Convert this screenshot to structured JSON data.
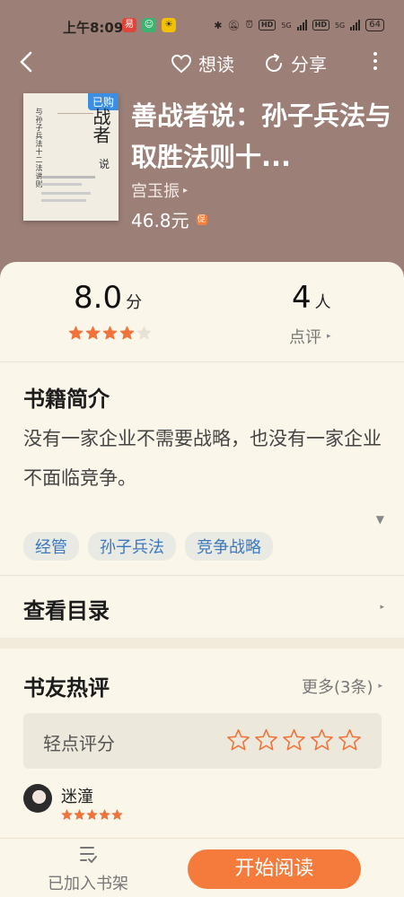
{
  "status_bar": {
    "time": "上午8:09",
    "battery": "64",
    "network": "5G",
    "hd": "HD"
  },
  "header": {
    "want_read_label": "想读",
    "share_label": "分享"
  },
  "book": {
    "purchased_badge": "已购",
    "title": "善战者说：孙子兵法与取胜法则十...",
    "author": "宫玉振",
    "price": "46.8元",
    "price_badge": "促",
    "cover": {
      "vertical_text": "与孙子兵法十二法讲则",
      "big_text": "战者",
      "say_char": "说"
    }
  },
  "rating": {
    "score": "8.0",
    "score_unit": "分",
    "stars_filled": 4,
    "stars_total": 5,
    "reviewer_count": "4",
    "reviewer_unit": "人",
    "reviews_link": "点评"
  },
  "intro": {
    "title": "书籍简介",
    "text": "没有一家企业不需要战略，也没有一家企业不面临竞争。"
  },
  "tags": [
    "经管",
    "孙子兵法",
    "竞争战略"
  ],
  "toc": {
    "label": "查看目录"
  },
  "hot_reviews": {
    "title": "书友热评",
    "more_label": "更多(3条)",
    "rate_prompt": "轻点评分",
    "user_name": "迷潼",
    "user_stars": 5
  },
  "bottom_bar": {
    "shelf_label": "已加入书架",
    "read_button": "开始阅读"
  },
  "colors": {
    "header_bg": "#9c7f77",
    "card_bg": "#fbf6ea",
    "accent_orange": "#f47b3c",
    "star_orange": "#f0733a",
    "tag_text": "#3c78c0"
  }
}
